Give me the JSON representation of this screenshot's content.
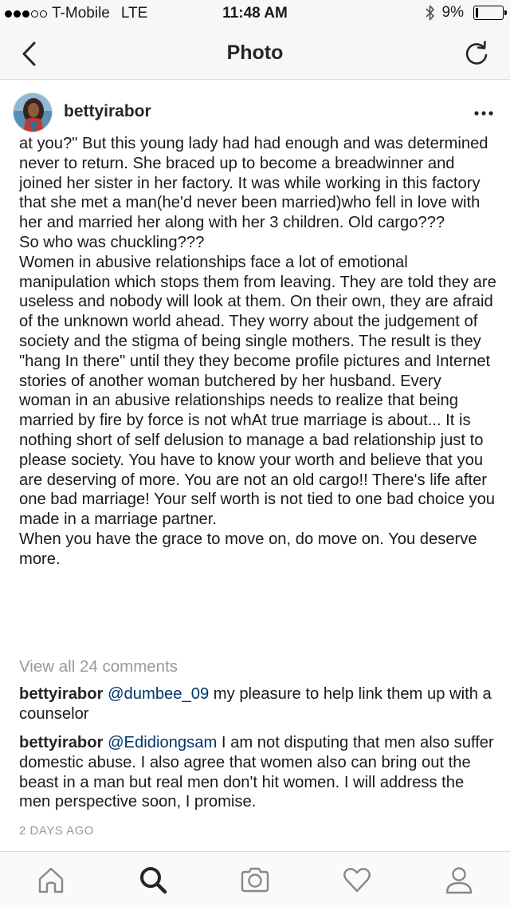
{
  "status_bar": {
    "carrier": "T-Mobile",
    "network": "LTE",
    "time": "11:48 AM",
    "battery_percent": "9%",
    "battery_level": 0.09,
    "signal_bars": 3
  },
  "nav": {
    "title": "Photo",
    "back_icon": "chevron-left-icon",
    "refresh_icon": "refresh-icon"
  },
  "post": {
    "username": "bettyirabor",
    "more_icon": "ellipsis-icon",
    "caption": "at you?\" But this young lady had had enough and was determined never to return. She braced up to become a breadwinner and joined her sister in her factory. It was while working in this factory that she met a man(he'd never been married)who fell in love with her and married her along with her 3 children. Old cargo???",
    "caption_2": "So who was chuckling???",
    "caption_3": "Women in abusive relationships face a lot of emotional manipulation which stops them from leaving. They are told they are useless and nobody will look at them. On their own, they are afraid of the unknown world ahead. They worry about the judgement of society and the stigma of being single mothers. The result is they \"hang In there\" until they they become profile pictures and Internet stories of another woman butchered by her husband. Every woman in an abusive relationships needs to realize that being married by fire by force is not whAt true marriage is about... It is nothing short of self delusion to manage a bad relationship just to please society. You have to know your worth and  believe that you are deserving of more. You are not an old cargo!! There's life after one bad marriage! Your self worth is not tied to one bad choice you made in a marriage partner.",
    "caption_4": "When you have the grace to move on, do move on. You deserve more.",
    "view_all_comments": "View all 24 comments",
    "comments": [
      {
        "user": "bettyirabor",
        "mention": "@dumbee_09",
        "text": " my pleasure to help link them up with a counselor"
      },
      {
        "user": "bettyirabor",
        "mention": "@Edidiongsam",
        "text": " I am not disputing that men also suffer domestic abuse. I also agree that women also can bring out the beast in a man but real men don't hit women. I will address the men perspective soon, I promise."
      }
    ],
    "timestamp": "2 DAYS AGO"
  },
  "tab_bar": {
    "items": [
      {
        "icon": "home-icon",
        "active": false
      },
      {
        "icon": "search-icon",
        "active": true
      },
      {
        "icon": "camera-icon",
        "active": false
      },
      {
        "icon": "heart-icon",
        "active": false
      },
      {
        "icon": "profile-icon",
        "active": false
      }
    ]
  },
  "colors": {
    "text": "#1a1a1a",
    "muted": "#999999",
    "mention": "#003569",
    "bar_bg": "#f7f7f7"
  }
}
